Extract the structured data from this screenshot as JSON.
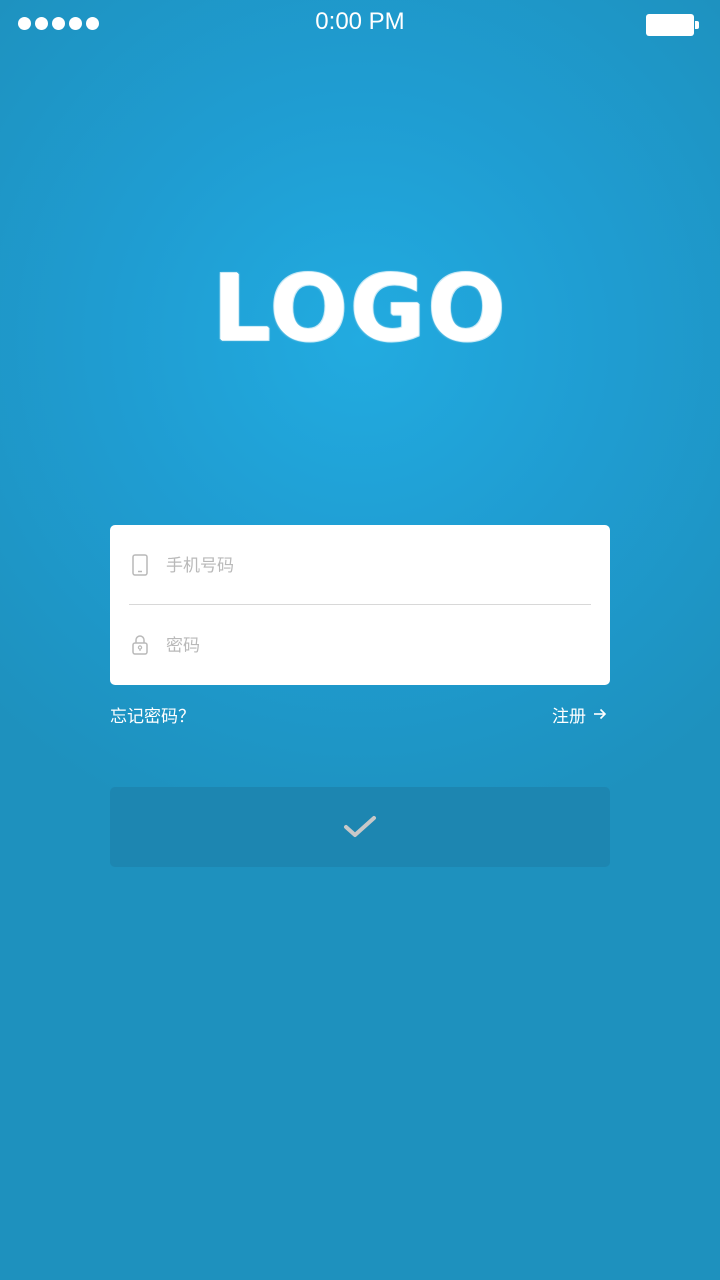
{
  "status_bar": {
    "time": "0:00 PM",
    "signal_icon": "signal-dots-icon",
    "battery_icon": "battery-icon"
  },
  "logo": {
    "text": "LOGO"
  },
  "login_form": {
    "phone": {
      "placeholder": "手机号码",
      "value": "",
      "icon": "mobile-phone-icon"
    },
    "password": {
      "placeholder": "密码",
      "value": "",
      "icon": "lock-icon"
    }
  },
  "links": {
    "forgot_password": "忘记密码？",
    "register": "注册",
    "register_icon": "arrow-right-icon"
  },
  "submit": {
    "icon": "check-icon"
  },
  "colors": {
    "background": "#1e91be",
    "background_glow": "#22abe0",
    "card": "#ffffff",
    "placeholder": "#b9b9b9",
    "submit_button": "#1d86b1",
    "check": "#c8c8c8"
  }
}
